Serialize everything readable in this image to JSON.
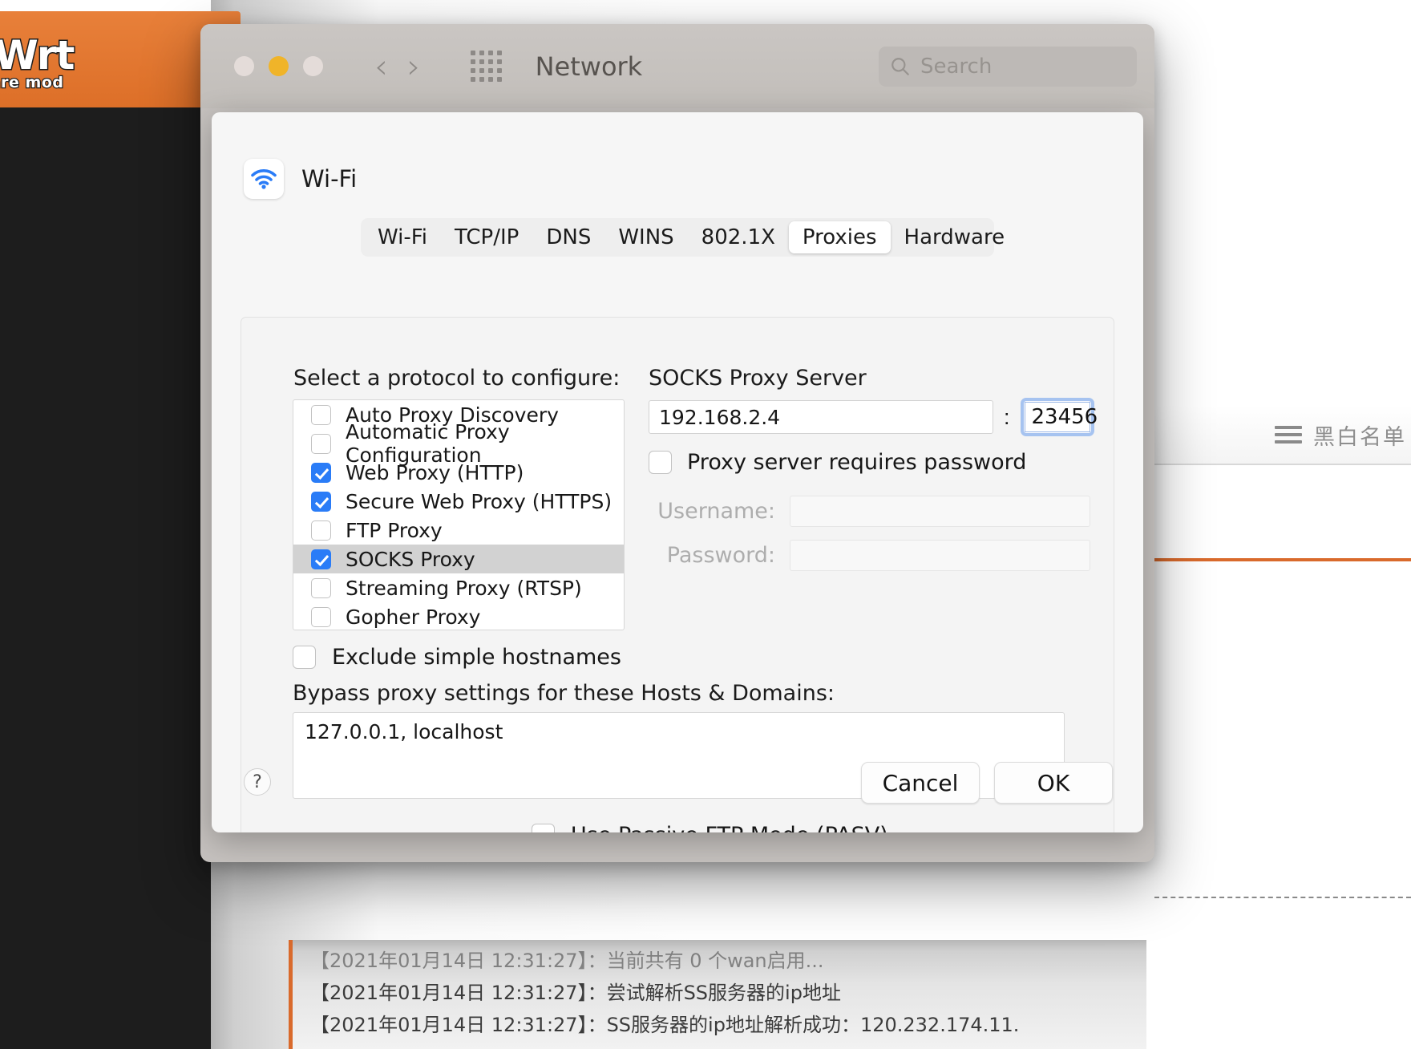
{
  "background": {
    "logo_main": "nWrt",
    "logo_sub": "share mod",
    "menu_label": "黑白名单",
    "log_lines": [
      "【2021年01月14日 12:31:27】：当前共有 0 个wan启用...",
      "【2021年01月14日 12:31:27】：尝试解析SS服务器的ip地址",
      "【2021年01月14日 12:31:27】：SS服务器的ip地址解析成功：120.232.174.11."
    ],
    "accent_orange": "#d96a2c"
  },
  "window": {
    "title": "Network",
    "search_placeholder": "Search",
    "traffic_lights": [
      "close-red",
      "minimize-yellow",
      "zoom-green"
    ]
  },
  "sheet": {
    "interface_name": "Wi-Fi",
    "tabs": [
      {
        "label": "Wi-Fi",
        "active": false
      },
      {
        "label": "TCP/IP",
        "active": false
      },
      {
        "label": "DNS",
        "active": false
      },
      {
        "label": "WINS",
        "active": false
      },
      {
        "label": "802.1X",
        "active": false
      },
      {
        "label": "Proxies",
        "active": true
      },
      {
        "label": "Hardware",
        "active": false
      }
    ],
    "protocol_section_label": "Select a protocol to configure:",
    "protocols": [
      {
        "label": "Auto Proxy Discovery",
        "checked": false,
        "selected": false
      },
      {
        "label": "Automatic Proxy Configuration",
        "checked": false,
        "selected": false
      },
      {
        "label": "Web Proxy (HTTP)",
        "checked": true,
        "selected": false
      },
      {
        "label": "Secure Web Proxy (HTTPS)",
        "checked": true,
        "selected": false
      },
      {
        "label": "FTP Proxy",
        "checked": false,
        "selected": false
      },
      {
        "label": "SOCKS Proxy",
        "checked": true,
        "selected": true
      },
      {
        "label": "Streaming Proxy (RTSP)",
        "checked": false,
        "selected": false
      },
      {
        "label": "Gopher Proxy",
        "checked": false,
        "selected": false
      }
    ],
    "exclude_simple_hostnames": {
      "label": "Exclude simple hostnames",
      "checked": false
    },
    "bypass_label": "Bypass proxy settings for these Hosts & Domains:",
    "bypass_value": "127.0.0.1, localhost",
    "passive_ftp": {
      "label": "Use Passive FTP Mode (PASV)",
      "checked": false
    },
    "server_section_label": "SOCKS Proxy Server",
    "server_host": "192.168.2.4",
    "server_port": "23456",
    "port_separator": ":",
    "requires_password": {
      "label": "Proxy server requires password",
      "checked": false
    },
    "username_label": "Username:",
    "username_value": "",
    "password_label": "Password:",
    "password_value": "",
    "help_label": "?",
    "cancel_label": "Cancel",
    "ok_label": "OK",
    "focus_ring_color": "#a6c3f0",
    "checkbox_accent": "#2a7cf7"
  }
}
